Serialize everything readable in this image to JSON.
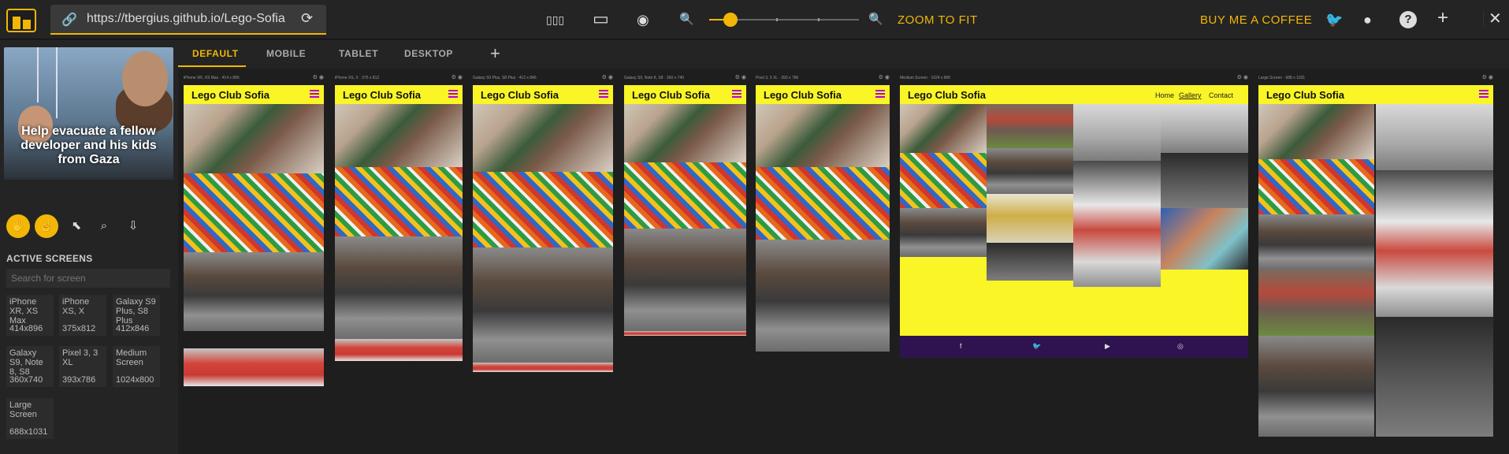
{
  "app": {
    "url": "https://tbergius.github.io/Lego-Sofia",
    "zoom_to_fit": "ZOOM TO FIT",
    "zoom_level": 0.14,
    "buy_coffee": "BUY ME A COFFEE"
  },
  "icons": {
    "link": "🔗",
    "reload": "⟳",
    "columns": "▯▯▯",
    "screen": "▭",
    "camera": "◉",
    "zoom_out": "🔍",
    "zoom_in": "🔍",
    "twitter": "🐦",
    "github": "●",
    "help": "?",
    "add": "+",
    "close": "✕"
  },
  "sidebar": {
    "ad_text": "Help evacuate a fellow developer and his kids from Gaza",
    "tools": [
      "✋",
      "☝",
      "⬉",
      "⌕",
      "⇩"
    ],
    "section_title": "ACTIVE SCREENS",
    "search_placeholder": "Search for screen",
    "screens": [
      {
        "name": "iPhone XR, XS Max",
        "dim": "414x896"
      },
      {
        "name": "iPhone XS, X",
        "dim": "375x812"
      },
      {
        "name": "Galaxy S9 Plus, S8 Plus",
        "dim": "412x846"
      },
      {
        "name": "Galaxy S9, Note 8, S8",
        "dim": "360x740"
      },
      {
        "name": "Pixel 3, 3 XL",
        "dim": "393x786"
      },
      {
        "name": "Medium Screen",
        "dim": "1024x800"
      },
      {
        "name": "Large Screen",
        "dim": "688x1031"
      }
    ]
  },
  "tabs": [
    "DEFAULT",
    "MOBILE",
    "TABLET",
    "DESKTOP"
  ],
  "devices": [
    {
      "label": "iPhone XR, XS Max · 414 x 896"
    },
    {
      "label": "iPhone XS, X · 375 x 812"
    },
    {
      "label": "Galaxy S9 Plus, S8 Plus · 412 x 846"
    },
    {
      "label": "Galaxy S9, Note 8, S8 · 360 x 740"
    },
    {
      "label": "Pixel 3, 3 XL · 393 x 786"
    },
    {
      "label": "Medium Screen · 1024 x 800"
    },
    {
      "label": "Large Screen · 688 x 1031"
    }
  ],
  "site": {
    "title": "Lego Club Sofia",
    "nav": [
      "Home",
      "Gallery",
      "Contact"
    ],
    "footer_icons": [
      "f",
      "🐦",
      "▶",
      "◎"
    ]
  },
  "device_icons": "⚙ ◉"
}
